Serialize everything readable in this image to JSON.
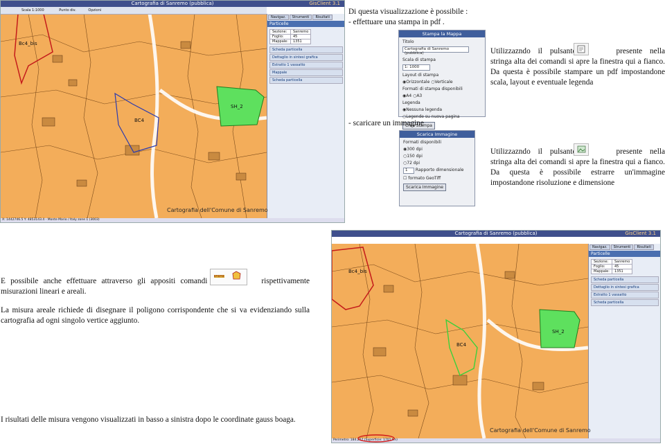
{
  "top_text": {
    "line1": "Di questa visualizzazione è possibile  :",
    "line2": "- effettuare una stampa in pdf ."
  },
  "pdf_section": {
    "text_a": "Utilizzazndo il pulsante",
    "text_b": "presente nella stringa alta dei comandi si apre la finestra qui a fianco. Da questa è possibile stampare un pdf impostandone scala, layout e eventuale legenda"
  },
  "image_heading": "- scaricare un immagine",
  "image_section": {
    "text_a": "Utilizzazndo il pulsante",
    "text_b": "presente nella stringa alta dei comandi si apre la finestra qui a fianco. Da questa è possibile estrarre un'immagine impostandone risoluzione e dimensione"
  },
  "measure_text": {
    "p1a": "E possibile anche effettuare attraverso gli appositi comandi",
    "p1b": "rispettivamente misurazioni lineari e areali.",
    "p2": "La misura areale richiede di disegnare il poligono corrispondente che si va evidenziando sulla cartografia  ad ogni singolo vertice aggiunto."
  },
  "results_text": "I risultati delle misura vengono visualizzati in basso a sinistra dopo le coordinate gauss boaga.",
  "app": {
    "title": "Cartografia di Sanremo (pubblica)",
    "brand": "GisClient 3.1",
    "scale": "Scala 1:1000",
    "tool1": "Punto div.",
    "tool2": "Opzioni",
    "tabs": [
      "Navigaz.",
      "Strumenti",
      "Risultati"
    ],
    "panel_title": "Particelle",
    "fields": [
      {
        "label": "Sezione:",
        "value": "Sanremo"
      },
      {
        "label": "Foglio:",
        "value": "45"
      },
      {
        "label": "Mappale:",
        "value": "1351"
      }
    ],
    "options": [
      "Scheda particella",
      "Dettaglio in sintesi grafica",
      "Estratto 1 vassatto",
      "Mappale",
      "Scheda particella"
    ],
    "watermark": "Cartografia dell'Comune di Sanremo",
    "map_labels": [
      "Bc4_bis",
      "BC4",
      "SH_2",
      "Bc4_bis",
      "BC4",
      "SH_2"
    ],
    "status1": "X: 1442746.5 Y: 4853143.4 - Monte Mario / Italy zone 1 (3003)",
    "status2": "Perimetro: 184.257 (Superficie: 1701 tm)"
  },
  "print_dialog": {
    "title": "Stampa la Mappa",
    "titolo_label": "Titolo",
    "titolo_value": "Cartografia di Sanremo (pubblica)",
    "scala_label": "Scala di stampa",
    "scala_value": "1: 1000",
    "layout_label": "Layout di stampa",
    "layout_opts": [
      "Orizzontale",
      "Verticale"
    ],
    "formati_label": "Formati di stampa disponibili",
    "formati_opts": [
      "A4",
      "A3"
    ],
    "legenda_label": "Legenda",
    "legenda_opts": [
      "Nessuna legenda",
      "Legende su nuova pagina"
    ],
    "button": "Crea Stampa"
  },
  "image_dialog": {
    "title": "Scarica Immagine",
    "formati_label": "Formati disponibili",
    "formati_opts": [
      "300 dpi",
      "150 dpi",
      "72 dpi"
    ],
    "ratio_value": "1",
    "ratio_label": "Rapporto dimensionale",
    "geotiff": "formato GeoTiff",
    "button": "Scarica Immagine"
  },
  "colors": {
    "map": "#f3ad5a",
    "green_parcel": "#5ee05e",
    "panel_header": "#4a6fb0",
    "title_bar": "#3f4f8c"
  }
}
